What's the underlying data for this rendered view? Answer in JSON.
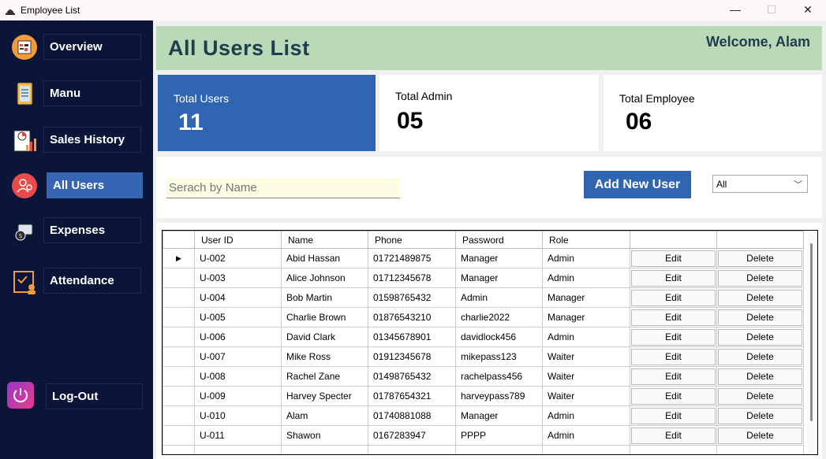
{
  "window": {
    "title": "Employee List",
    "minimize": "—",
    "maximize": "☐",
    "close": "✕"
  },
  "sidebar": {
    "items": [
      {
        "label": "Overview",
        "icon": "overview-icon"
      },
      {
        "label": "Manu",
        "icon": "menu-icon"
      },
      {
        "label": "Sales History",
        "icon": "sales-history-icon"
      },
      {
        "label": "All Users",
        "icon": "users-icon",
        "active": true
      },
      {
        "label": "Expenses",
        "icon": "expenses-icon"
      },
      {
        "label": "Attendance",
        "icon": "attendance-icon"
      }
    ],
    "logout": {
      "label": "Log-Out",
      "icon": "power-icon"
    }
  },
  "header": {
    "title": "All Users List",
    "welcome": "Welcome, Alam"
  },
  "stats": [
    {
      "label": "Total Users",
      "value": "11"
    },
    {
      "label": "Total Admin",
      "value": "05"
    },
    {
      "label": "Total Employee",
      "value": "06"
    }
  ],
  "toolbar": {
    "search_placeholder": "Serach by Name",
    "add_button": "Add New User",
    "filter_selected": "All"
  },
  "table": {
    "columns": [
      "User ID",
      "Name",
      "Phone",
      "Password",
      "Role",
      "",
      ""
    ],
    "edit_label": "Edit",
    "delete_label": "Delete",
    "rows": [
      [
        "U-002",
        "Abid Hassan",
        "01721489875",
        "Manager",
        "Admin"
      ],
      [
        "U-003",
        "Alice Johnson",
        "01712345678",
        "Manager",
        "Admin"
      ],
      [
        "U-004",
        "Bob Martin",
        "01598765432",
        "Admin",
        "Manager"
      ],
      [
        "U-005",
        "Charlie Brown",
        "01876543210",
        "charlie2022",
        "Manager"
      ],
      [
        "U-006",
        "David Clark",
        "01345678901",
        "davidlock456",
        "Admin"
      ],
      [
        "U-007",
        "Mike Ross",
        "01912345678",
        "mikepass123",
        "Waiter"
      ],
      [
        "U-008",
        "Rachel Zane",
        "01498765432",
        "rachelpass456",
        "Waiter"
      ],
      [
        "U-009",
        "Harvey Specter",
        "01787654321",
        "harveypass789",
        "Waiter"
      ],
      [
        "U-010",
        "Alam",
        "01740881088",
        "Manager",
        "Admin"
      ],
      [
        "U-011",
        "Shawon",
        "0167283947",
        "PPPP",
        "Admin"
      ]
    ],
    "selected_row_marker": "▶"
  },
  "colors": {
    "sidebar_bg": "#0a1538",
    "accent": "#2f65b1",
    "header_bg": "#b9d9b7",
    "header_text": "#203d4e"
  }
}
